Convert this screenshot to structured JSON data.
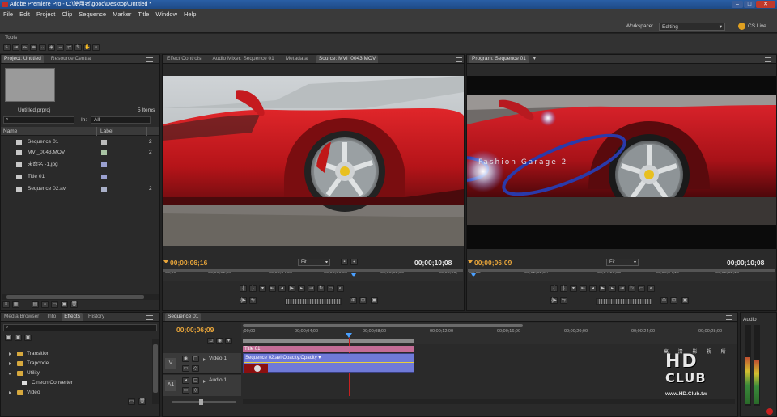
{
  "window": {
    "title": "Adobe Premiere Pro - C:\\使用者\\gooo\\Desktop\\Untitled *"
  },
  "menu": [
    "File",
    "Edit",
    "Project",
    "Clip",
    "Sequence",
    "Marker",
    "Title",
    "Window",
    "Help"
  ],
  "workspace": {
    "label": "Workspace:",
    "value": "Editing",
    "cslive": "CS Live"
  },
  "tools": {
    "panel_title": "Tools"
  },
  "project": {
    "tabs": [
      "Project: Untitled",
      "Resource Central"
    ],
    "filename": "Untitled.prproj",
    "item_count": "5 Items",
    "in_label": "In:",
    "in_value": "All",
    "columns": {
      "name": "Name",
      "label": "Label"
    },
    "items": [
      {
        "name": "Sequence 01",
        "color": "#bcbcbc",
        "n": "2"
      },
      {
        "name": "MVI_0043.MOV",
        "color": "#a9c4a4",
        "n": "2"
      },
      {
        "name": "未命名 -1.jpg",
        "color": "#9aa0d0",
        "n": ""
      },
      {
        "name": "Title 01",
        "color": "#9aa0d0",
        "n": ""
      },
      {
        "name": "Sequence 02.avi",
        "color": "#a9b0c8",
        "n": "2"
      }
    ]
  },
  "source": {
    "tabs": [
      "Effect Controls",
      "Audio Mixer: Sequence 01",
      "Metadata",
      "Source: MVI_0043.MOV"
    ],
    "tc_current": "00;00;06;16",
    "tc_duration": "00;00;10;08",
    "fit": "Fit",
    "ruler": [
      "00;00",
      "00;00;02;00",
      "00;00;04;00",
      "00;00;06;00",
      "00;00;08;00",
      "00;00;10;"
    ]
  },
  "program": {
    "tabs": [
      "Program: Sequence 01"
    ],
    "tc_current": "00;00;06;09",
    "tc_duration": "00;00;10;08",
    "fit": "Fit",
    "overlay_text": "Fashion Garage 2",
    "ruler": [
      "00;00",
      "00;02;08;04",
      "00;04;16;08",
      "00;06;24;12",
      "00;08;32;16"
    ]
  },
  "effects": {
    "tabs": [
      "Media Browser",
      "Info",
      "Effects",
      "History"
    ],
    "items": [
      {
        "name": "Transition",
        "type": "folder",
        "open": false
      },
      {
        "name": "Trapcode",
        "type": "folder",
        "open": false
      },
      {
        "name": "Utility",
        "type": "folder",
        "open": true
      },
      {
        "name": "Cineon Converter",
        "type": "effect",
        "open": false
      },
      {
        "name": "Video",
        "type": "folder",
        "open": false
      }
    ]
  },
  "timeline": {
    "tabs": [
      "Sequence 01"
    ],
    "tc_current": "00;00;06;09",
    "ruler": [
      ";00;00",
      "00;00;04;00",
      "00;00;08;00",
      "00;00;12;00",
      "00;00;16;00",
      "00;00;20;00",
      "00;00;24;00",
      "00;00;28;00"
    ],
    "tracks": {
      "video": {
        "label": "Video 1",
        "target": "V"
      },
      "audio": {
        "label": "Audio 1",
        "target": "A1"
      }
    },
    "title_clip": "Title 01",
    "video_clip": "Sequence 02.avi  Opacity:Opacity ▾"
  },
  "audio_meter": {
    "title": "Audio"
  },
  "watermark": {
    "line1": "HD",
    "line2": "CLUB",
    "url": "www.HD.Club.tw",
    "chars": "高 清 影 視 所"
  },
  "colors": {
    "accent_orange": "#e8a53a",
    "clip_blue": "#6f7ad8",
    "clip_pink": "#c36c96",
    "playhead_red": "#c82020"
  }
}
